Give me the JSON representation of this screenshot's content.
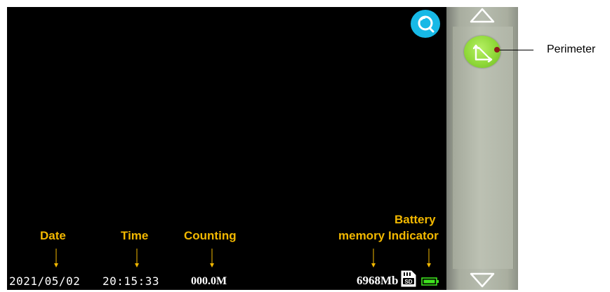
{
  "status_bar": {
    "date": "2021/05/02",
    "time": "20:15:33",
    "counting": "000.0M",
    "memory": "6968Mb"
  },
  "annotations": {
    "date": "Date",
    "time": "Time",
    "counting": "Counting",
    "memory": "memory",
    "battery_line1": "Battery",
    "battery_line2": "Indicator",
    "perimeter": "Perimeter"
  },
  "icons": {
    "search": "search-icon",
    "perimeter": "perimeter-icon",
    "scroll_up": "triangle-up-icon",
    "scroll_down": "triangle-down-icon",
    "sd_card": "sd-card-icon",
    "battery": "battery-icon"
  },
  "colors": {
    "screen_background": "#000000",
    "annotation_text": "#f2b800",
    "search_button": "#17b9e6",
    "perimeter_button": "#8fd838",
    "battery_fill": "#3fe21f",
    "callout_dot": "#8a1a1a"
  },
  "battery_level": 1.0
}
